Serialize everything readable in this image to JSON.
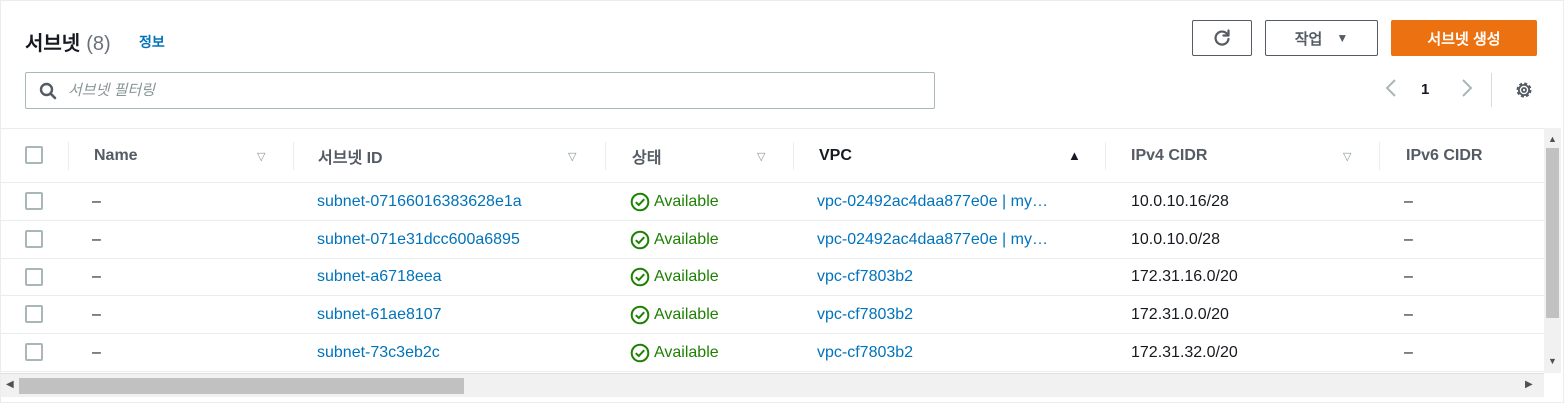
{
  "header": {
    "title": "서브넷",
    "count": "(8)",
    "info_link": "정보",
    "refresh_label": "",
    "actions_label": "작업",
    "create_label": "서브넷 생성"
  },
  "search": {
    "placeholder": "서브넷 필터링",
    "value": ""
  },
  "pagination": {
    "current_page": "1"
  },
  "table": {
    "columns": [
      "Name",
      "서브넷 ID",
      "상태",
      "VPC",
      "IPv4 CIDR",
      "IPv6 CIDR"
    ],
    "rows": [
      {
        "name": "–",
        "subnet_id": "subnet-07166016383628e1a",
        "state": "Available",
        "vpc": "vpc-02492ac4daa877e0e | my…",
        "ipv4": "10.0.10.16/28",
        "ipv6": "–"
      },
      {
        "name": "–",
        "subnet_id": "subnet-071e31dcc600a6895",
        "state": "Available",
        "vpc": "vpc-02492ac4daa877e0e | my…",
        "ipv4": "10.0.10.0/28",
        "ipv6": "–"
      },
      {
        "name": "–",
        "subnet_id": "subnet-a6718eea",
        "state": "Available",
        "vpc": "vpc-cf7803b2",
        "ipv4": "172.31.16.0/20",
        "ipv6": "–"
      },
      {
        "name": "–",
        "subnet_id": "subnet-61ae8107",
        "state": "Available",
        "vpc": "vpc-cf7803b2",
        "ipv4": "172.31.0.0/20",
        "ipv6": "–"
      },
      {
        "name": "–",
        "subnet_id": "subnet-73c3eb2c",
        "state": "Available",
        "vpc": "vpc-cf7803b2",
        "ipv4": "172.31.32.0/20",
        "ipv6": "–"
      }
    ]
  },
  "colors": {
    "primary_button": "#ec7211",
    "link": "#0073bb",
    "status_success": "#1d8102"
  },
  "icons": {
    "refresh": "refresh-icon",
    "search": "search-icon",
    "settings": "gear-icon",
    "status": "check-circle-icon"
  }
}
